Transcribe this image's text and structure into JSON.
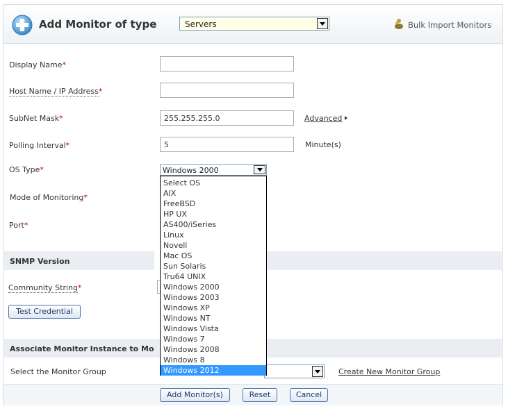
{
  "header": {
    "title": "Add Monitor of type",
    "monitor_type": "Servers",
    "bulk_import_label": "Bulk Import Monitors"
  },
  "form": {
    "display_name": {
      "label": "Display Name",
      "value": ""
    },
    "host_name": {
      "label": "Host Name / IP Address",
      "value": ""
    },
    "subnet_mask": {
      "label": "SubNet Mask",
      "value": "255.255.255.0"
    },
    "advanced_link": "Advanced",
    "polling_interval": {
      "label": "Polling Interval",
      "value": "5",
      "unit": "Minute(s)"
    },
    "os_type": {
      "label": "OS Type",
      "value": "Windows 2000"
    },
    "mode_of_monitoring": {
      "label": "Mode of Monitoring"
    },
    "port": {
      "label": "Port"
    },
    "required_mark": "*"
  },
  "snmp": {
    "section_label": "SNMP Version",
    "community_string_label": "Community String",
    "test_credential_button": "Test Credential"
  },
  "associate": {
    "section_label": "Associate Monitor Instance to Mo",
    "group_label": "Select the Monitor Group",
    "create_group_link": "Create New Monitor Group"
  },
  "os_options": [
    "Select OS",
    "AIX",
    "FreeBSD",
    "HP UX",
    "AS400/iSeries",
    "Linux",
    "Novell",
    "Mac OS",
    "Sun Solaris",
    "Tru64 UNIX",
    "Windows 2000",
    "Windows 2003",
    "Windows XP",
    "Windows NT",
    "Windows Vista",
    "Windows 7",
    "Windows 2008",
    "Windows 8",
    "Windows 2012"
  ],
  "os_highlighted": "Windows 2012",
  "buttons": {
    "add": "Add Monitor(s)",
    "reset": "Reset",
    "cancel": "Cancel"
  },
  "colors": {
    "highlight": "#3399ff",
    "required": "#cc0000",
    "section_bg": "#eaeef2"
  }
}
